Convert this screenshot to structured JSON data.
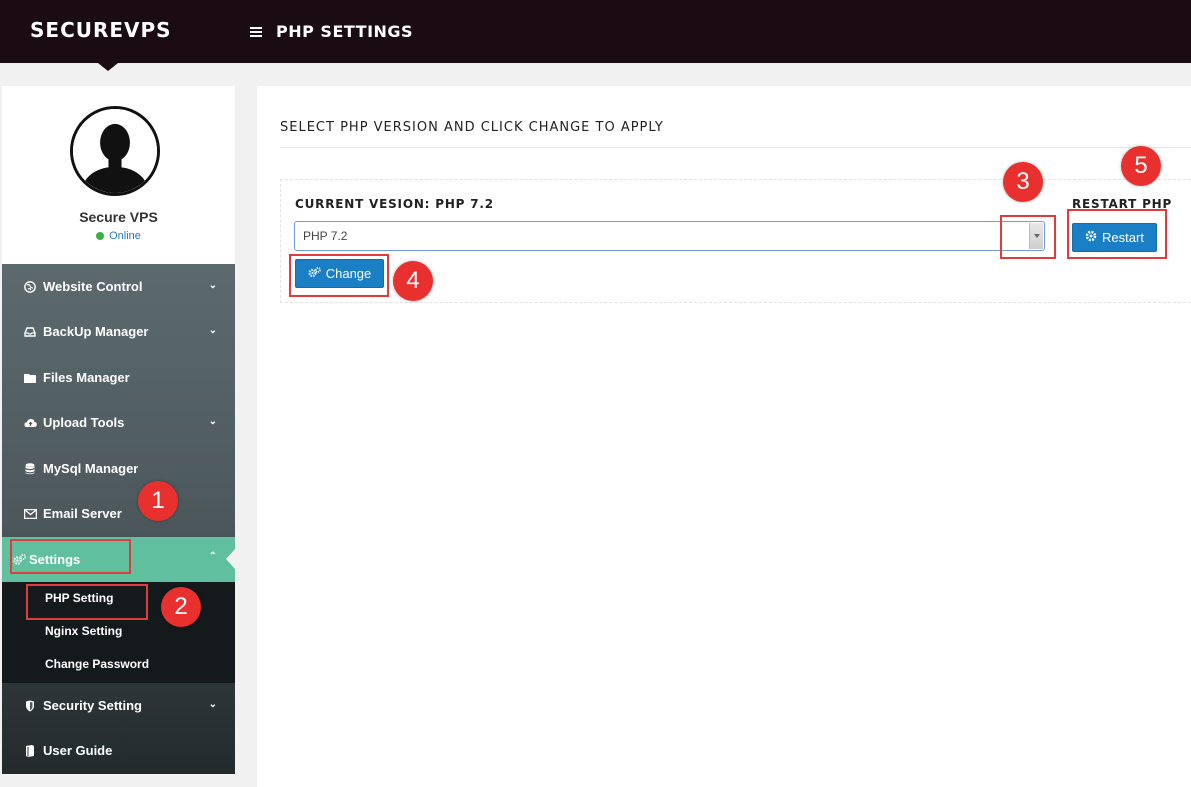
{
  "app": {
    "brand": "SECUREVPS",
    "page_title": "PHP SETTINGS"
  },
  "profile": {
    "name": "Secure VPS",
    "status": "Online",
    "status_color": "#3cb043"
  },
  "sidebar": {
    "items": [
      {
        "label": "Website Control",
        "icon": "globe-icon",
        "expandable": true
      },
      {
        "label": "BackUp Manager",
        "icon": "inbox-icon",
        "expandable": true
      },
      {
        "label": "Files Manager",
        "icon": "folder-icon",
        "expandable": false
      },
      {
        "label": "Upload Tools",
        "icon": "cloud-upload-icon",
        "expandable": true
      },
      {
        "label": "MySql Manager",
        "icon": "database-icon",
        "expandable": false
      },
      {
        "label": "Email Server",
        "icon": "envelope-icon",
        "expandable": false
      },
      {
        "label": "Settings",
        "icon": "gears-icon",
        "expandable": true,
        "active": true
      },
      {
        "label": "Security Setting",
        "icon": "shield-icon",
        "expandable": true
      },
      {
        "label": "User Guide",
        "icon": "book-icon",
        "expandable": false
      }
    ],
    "settings_submenu": [
      {
        "label": "PHP Setting"
      },
      {
        "label": "Nginx Setting"
      },
      {
        "label": "Change Password"
      }
    ],
    "active_color": "#5fbf9f"
  },
  "main": {
    "section_title": "SELECT PHP VERSION AND CLICK CHANGE TO APPLY",
    "current_version_label": "CURRENT VESION: PHP 7.2",
    "php_select": {
      "selected": "PHP 7.2"
    },
    "change_button": "Change",
    "restart_label": "RESTART PHP",
    "restart_button": "Restart",
    "accent_color": "#1a7fc4"
  },
  "annotations": [
    "1",
    "2",
    "3",
    "4",
    "5"
  ]
}
